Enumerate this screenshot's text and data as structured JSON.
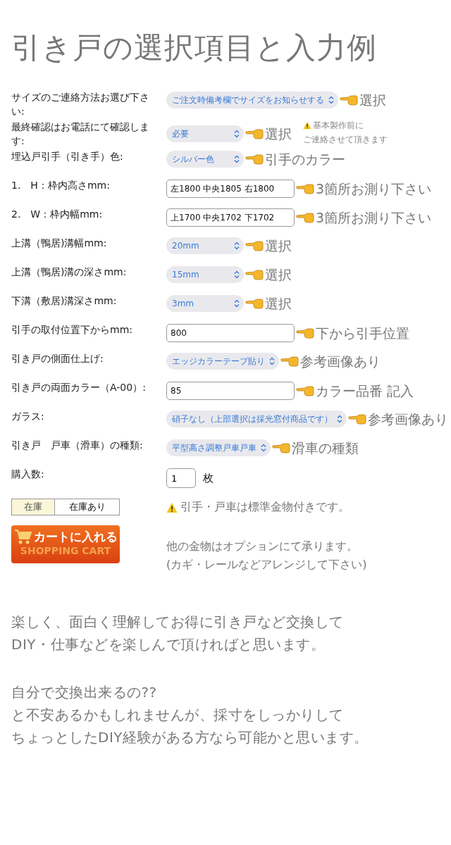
{
  "title": "引き戸の選択項目と入力例",
  "rows": [
    {
      "label": "サイズのご連絡方法お選び下さい:",
      "kind": "select",
      "value": "ご注文時備考欄でサイズをお知らせする",
      "hint": "選択"
    },
    {
      "label": "最終確認はお電話にて確認します:",
      "kind": "select",
      "value": "必要",
      "hint": "選択",
      "note_lines": [
        "基本製作前に",
        "ご連絡させて頂きます"
      ]
    },
    {
      "label": "埋込戸引手（引き手）色:",
      "kind": "select",
      "value": "シルバー色",
      "hint": "引手のカラー"
    },
    {
      "label": "1.　H：枠内高さmm:",
      "kind": "input",
      "value": "左1800 中央1805 右1800",
      "hint": "3箇所お測り下さい"
    },
    {
      "label": "2.　W：枠内幅mm:",
      "kind": "input",
      "value": "上1700 中央1702 下1702",
      "hint": "3箇所お測り下さい"
    },
    {
      "label": "上溝（鴨居)溝幅mm:",
      "kind": "select",
      "value": "20mm",
      "hint": "選択"
    },
    {
      "label": "上溝（鴨居)溝の深さmm:",
      "kind": "select",
      "value": "15mm",
      "hint": "選択"
    },
    {
      "label": "下溝（敷居)溝深さmm:",
      "kind": "select",
      "value": "3mm",
      "hint": "選択"
    },
    {
      "label": "引手の取付位置下からmm:",
      "kind": "input",
      "value": "800",
      "hint": "下から引手位置"
    },
    {
      "label": "引き戸の側面仕上げ:",
      "kind": "select",
      "value": "エッジカラーテープ貼り",
      "hint": "参考画像あり"
    },
    {
      "label": "引き戸の両面カラー（A-00）:",
      "kind": "input",
      "value": "85",
      "hint": "カラー品番 記入"
    },
    {
      "label": "ガラス:",
      "kind": "select",
      "value": "硝子なし（上部選択は採光窓付商品です）",
      "hint": "参考画像あり"
    },
    {
      "label": "引き戸　戸車（滑車）の種類:",
      "kind": "select",
      "value": "平型高さ調整戸車戸車",
      "hint": "滑車の種類"
    },
    {
      "label": "購入数:",
      "kind": "quantity",
      "value": "1",
      "unit": "枚"
    }
  ],
  "stock": {
    "label": "在庫",
    "value": "在庫あり"
  },
  "cart_button": {
    "label": "カートに入れる",
    "sublabel": "SHOPPING CART"
  },
  "notice": "引手・戸車は標準金物付きです。",
  "options_note": [
    "他の金物はオプションにて承ります。",
    "(カギ・レールなどアレンジして下さい)"
  ],
  "paragraphs": [
    [
      "楽しく、面白く理解してお得に引き戸など交換して",
      "DIY・仕事などを楽しんで頂ければと思います。"
    ],
    [
      "自分で交換出来るの??",
      "と不安あるかもしれませんが、採寸をしっかりして",
      "ちょっとしたDIY経験がある方なら可能かと思います。"
    ]
  ]
}
